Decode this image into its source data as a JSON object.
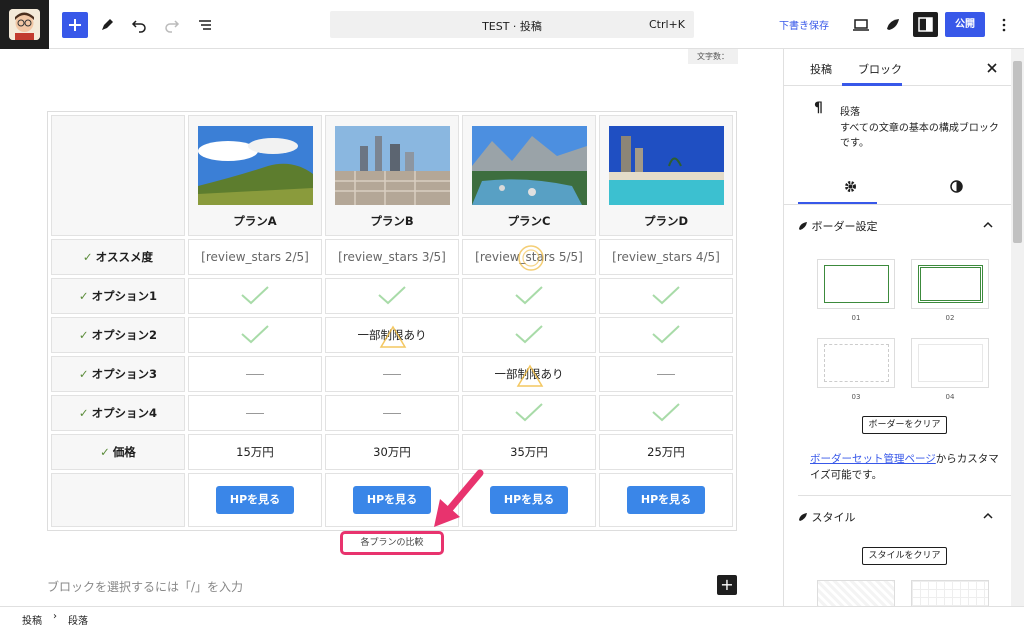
{
  "toolbar": {
    "command_title": "TEST · 投稿",
    "command_shortcut": "Ctrl+K",
    "save_draft": "下書き保存",
    "publish": "公開"
  },
  "editor": {
    "word_count_label": "文字数：",
    "table": {
      "plans": [
        "プランA",
        "プランB",
        "プランC",
        "プランD"
      ],
      "rows": [
        {
          "label": "オススメ度",
          "cells": [
            "[review_stars 2/5]",
            "[review_stars 3/5]",
            "[review_stars 5/5]",
            "[review_stars 4/5]"
          ]
        },
        {
          "label": "オプション1",
          "cells": [
            "check",
            "check",
            "check",
            "check"
          ]
        },
        {
          "label": "オプション2",
          "cells": [
            "check",
            "一部制限あり",
            "check",
            "check"
          ]
        },
        {
          "label": "オプション3",
          "cells": [
            "dash",
            "dash",
            "一部制限あり",
            "dash"
          ]
        },
        {
          "label": "オプション4",
          "cells": [
            "dash",
            "dash",
            "check",
            "check"
          ]
        },
        {
          "label": "価格",
          "cells": [
            "15万円",
            "30万円",
            "35万円",
            "25万円"
          ]
        }
      ],
      "button_label": "HPを見る"
    },
    "caption": "各プランの比較",
    "placeholder": "ブロックを選択するには「/」を入力"
  },
  "sidebar": {
    "tabs": [
      "投稿",
      "ブロック"
    ],
    "block_name": "段落",
    "block_desc": "すべての文章の基本の構成ブロックです。",
    "border_section": "ボーダー設定",
    "presets": [
      "01",
      "02",
      "03",
      "04"
    ],
    "clear_border": "ボーダーをクリア",
    "help_link": "ボーダーセット管理ページ",
    "help_text": "からカスタマイズ可能です。",
    "style_section": "スタイル",
    "clear_style": "スタイルをクリア"
  },
  "breadcrumb": [
    "投稿",
    "段落"
  ],
  "colors": {
    "accent": "#3858e9",
    "button": "#3a86e8",
    "highlight": "#e8336e",
    "check": "#a8dba8"
  }
}
